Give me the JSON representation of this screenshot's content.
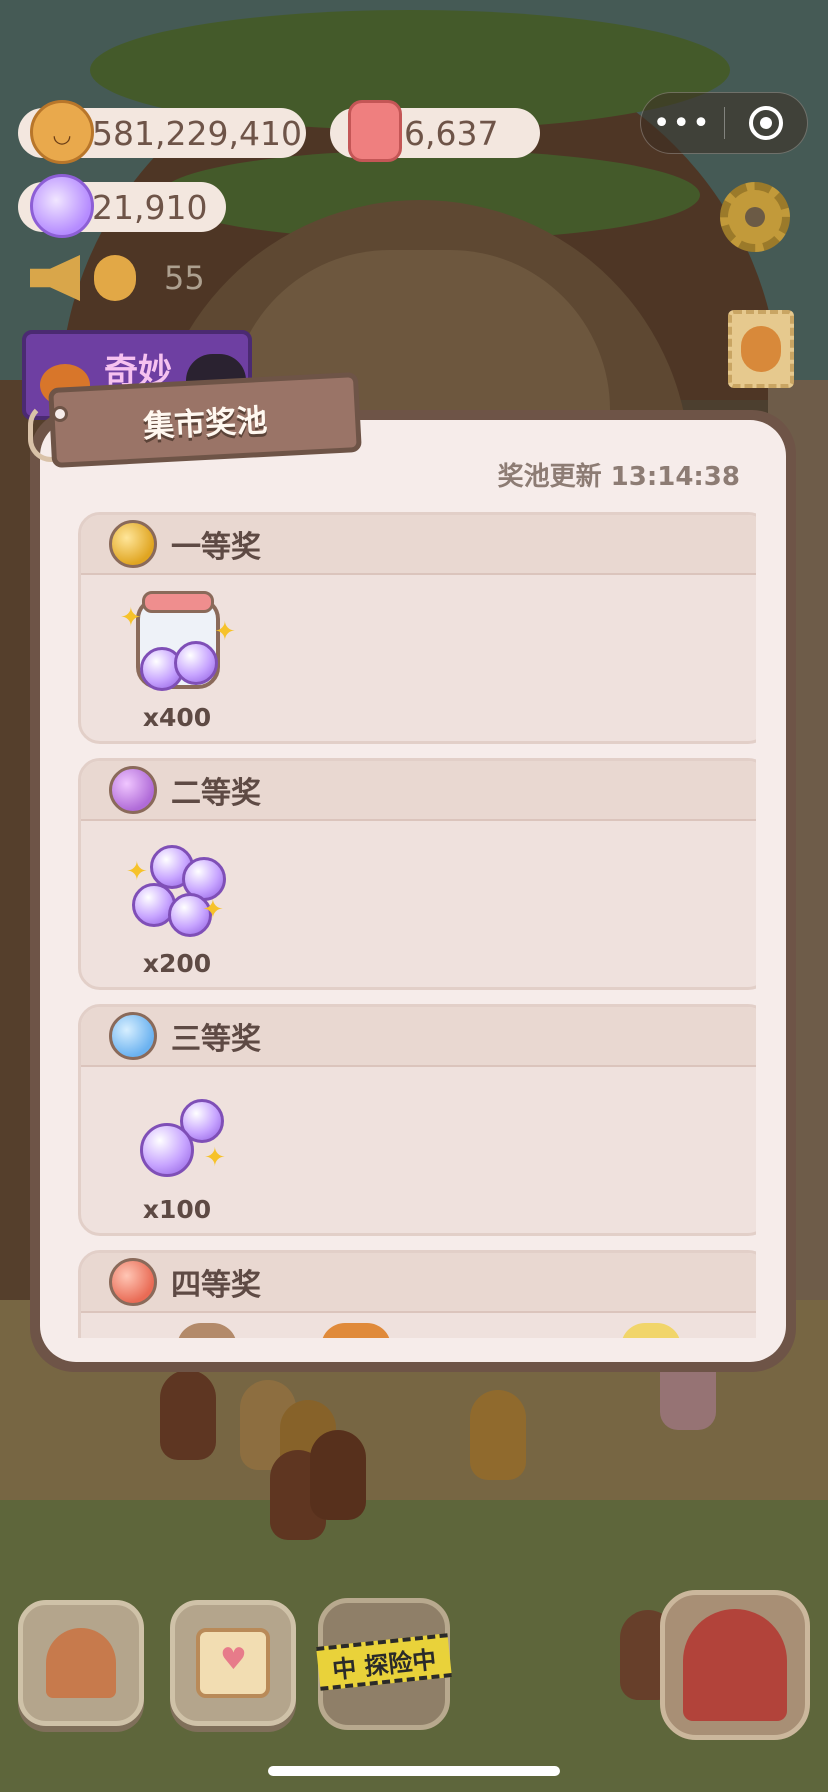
{
  "hud": {
    "coins": "581,229,410",
    "candles": "6,637",
    "candies": "21,910",
    "notice_count": "55",
    "event_banner_text": "奇妙"
  },
  "capsule": {
    "more_glyph": "•••",
    "close_icon": "target-circle"
  },
  "modal": {
    "title": "集市奖池",
    "refresh_label": "奖池更新 13:14:38",
    "tiers": [
      {
        "title": "一等奖",
        "orb_color": "#e0a521",
        "reward_qty": "x400",
        "reward_icon": "candy-jar-icon"
      },
      {
        "title": "二等奖",
        "orb_color": "#b06bd8",
        "reward_qty": "x200",
        "reward_icon": "candy-pile-icon"
      },
      {
        "title": "三等奖",
        "orb_color": "#6bb2f0",
        "reward_qty": "x100",
        "reward_icon": "candy-pair-icon"
      },
      {
        "title": "四等奖",
        "orb_color": "#e96b55"
      }
    ]
  },
  "dock": {
    "explore_tape": "中 探险中"
  },
  "colors": {
    "panel_bg": "#f6ecea",
    "panel_border": "#6e5447",
    "tier_bg": "#efe1dd",
    "text_main": "#5e4a44",
    "text_muted": "#8d7c74"
  }
}
